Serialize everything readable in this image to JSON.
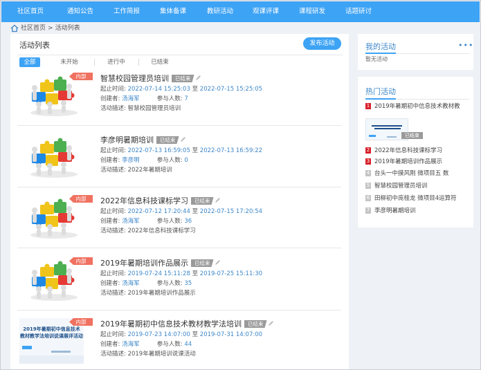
{
  "nav": [
    "社区首页",
    "通知公告",
    "工作简报",
    "集体备课",
    "教研活动",
    "观课评课",
    "课程研发",
    "话题研讨"
  ],
  "breadcrumb": {
    "home": "社区首页",
    "sep": ">",
    "current": "活动列表"
  },
  "main": {
    "title": "活动列表",
    "publish_label": "发布活动",
    "tabs": [
      "全部",
      "未开始",
      "进行中",
      "已结束"
    ]
  },
  "activities": [
    {
      "name": "智慧校园管理员培训",
      "status": "已结束",
      "internal": "内部",
      "time_label": "起止时间:",
      "start": "2022-07-14 15:25:03",
      "to": "至",
      "end": "2022-07-15 15:25:05",
      "creator_label": "创建者:",
      "creator": "汤海军",
      "participants_label": "参与人数:",
      "participants": "7",
      "desc_label": "活动描述:",
      "desc": "智慧校园管理员培训"
    },
    {
      "name": "李彦明暑期培训",
      "status": "已结束",
      "internal": "",
      "time_label": "起止时间:",
      "start": "2022-07-13 16:59:05",
      "to": "至",
      "end": "2022-07-13 16:59:22",
      "creator_label": "创建者:",
      "creator": "李彦明",
      "participants_label": "参与人数:",
      "participants": "0",
      "desc_label": "活动描述:",
      "desc": "2022年暑期培训"
    },
    {
      "name": "2022年信息科技课标学习",
      "status": "已结束",
      "internal": "内部",
      "time_label": "起止时间:",
      "start": "2022-07-12 17:20:44",
      "to": "至",
      "end": "2022-07-15 17:20:54",
      "creator_label": "创建者:",
      "creator": "汤海军",
      "participants_label": "参与人数:",
      "participants": "36",
      "desc_label": "活动描述:",
      "desc": "2022年信息科技课标学习"
    },
    {
      "name": "2019年暑期培训作品展示",
      "status": "已结束",
      "internal": "内部",
      "time_label": "起止时间:",
      "start": "2019-07-24 15:11:28",
      "to": "至",
      "end": "2019-07-25 15:11:30",
      "creator_label": "创建者:",
      "creator": "汤海军",
      "participants_label": "参与人数:",
      "participants": "35",
      "desc_label": "活动描述:",
      "desc": "2019年暑期培训作品展示"
    },
    {
      "name": "2019年暑期初中信息技术教材教学法培训",
      "status": "已结束",
      "internal": "内部",
      "time_label": "起止时间:",
      "start": "2019-07-23 14:07:00",
      "to": "至",
      "end": "2019-07-31 14:07:00",
      "creator_label": "创建者:",
      "creator": "汤海军",
      "participants_label": "参与人数:",
      "participants": "44",
      "desc_label": "活动描述:",
      "desc": "2019年暑期培训说课活动",
      "poster_text": [
        "2019年暑期初中信息技术",
        "教材教学法培训说课展评活动"
      ]
    }
  ],
  "my_activity": {
    "title": "我的活动",
    "more": "•••",
    "empty": "暂无活动"
  },
  "hot": {
    "title": "热门活动",
    "items": [
      {
        "rank": "1",
        "label": "2019年暑期初中信息技术教材教"
      },
      {
        "rank": "2",
        "label": "2022年信息科技课标学习"
      },
      {
        "rank": "3",
        "label": "2019年暑期培训作品展示"
      },
      {
        "rank": "4",
        "label": "台头一中摸风刚 微项目五 数"
      },
      {
        "rank": "5",
        "label": "智慧校园管理员培训"
      },
      {
        "rank": "6",
        "label": "田柳初中庞桂龙 微项目4运算符"
      },
      {
        "rank": "7",
        "label": "李彦明暑期培训"
      }
    ],
    "thumb_status": "已结束"
  },
  "colors": {
    "primary": "#3da3f5",
    "link": "#3d87c9",
    "internal": "#f07160",
    "ended": "#9a9a9a",
    "rank_top": "#d7202a"
  }
}
